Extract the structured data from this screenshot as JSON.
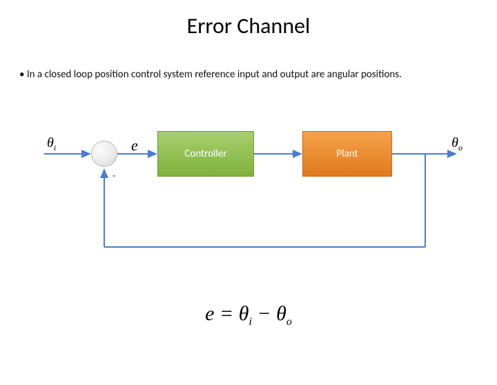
{
  "title": "Error Channel",
  "bullet_text": "In a closed loop position control system reference input and output  are angular positions.",
  "labels": {
    "theta_i": "θ",
    "theta_i_sub": "i",
    "theta_o": "θ",
    "theta_o_sub": "o",
    "error": "e",
    "minus": "-"
  },
  "blocks": {
    "controller": "Controller",
    "plant": "Plant"
  },
  "formula": {
    "lhs": "e",
    "eq": " = ",
    "t1": "θ",
    "s1": "i",
    "minus": " − ",
    "t2": "θ",
    "s2": "o"
  }
}
